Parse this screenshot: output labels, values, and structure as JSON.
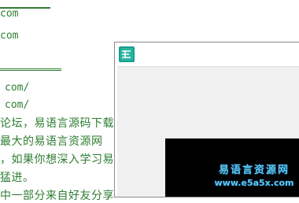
{
  "background_text": {
    "urls": [
      "com",
      "com",
      "com/",
      "com/"
    ],
    "paragraph_lines": [
      "论坛，易语言源码下载",
      "最大的易语言资源网",
      "，如果你想深入学习易",
      "猛进。",
      "中一部分来自好友分享"
    ]
  },
  "window": {
    "icon": "app-logo-icon"
  },
  "watermark": {
    "title": "易语言资源网",
    "url": "www.e5a5x.com"
  },
  "colors": {
    "text_green": "#2e7d32",
    "watermark_blue": "#5ec8f0",
    "panel_black": "#000000"
  }
}
